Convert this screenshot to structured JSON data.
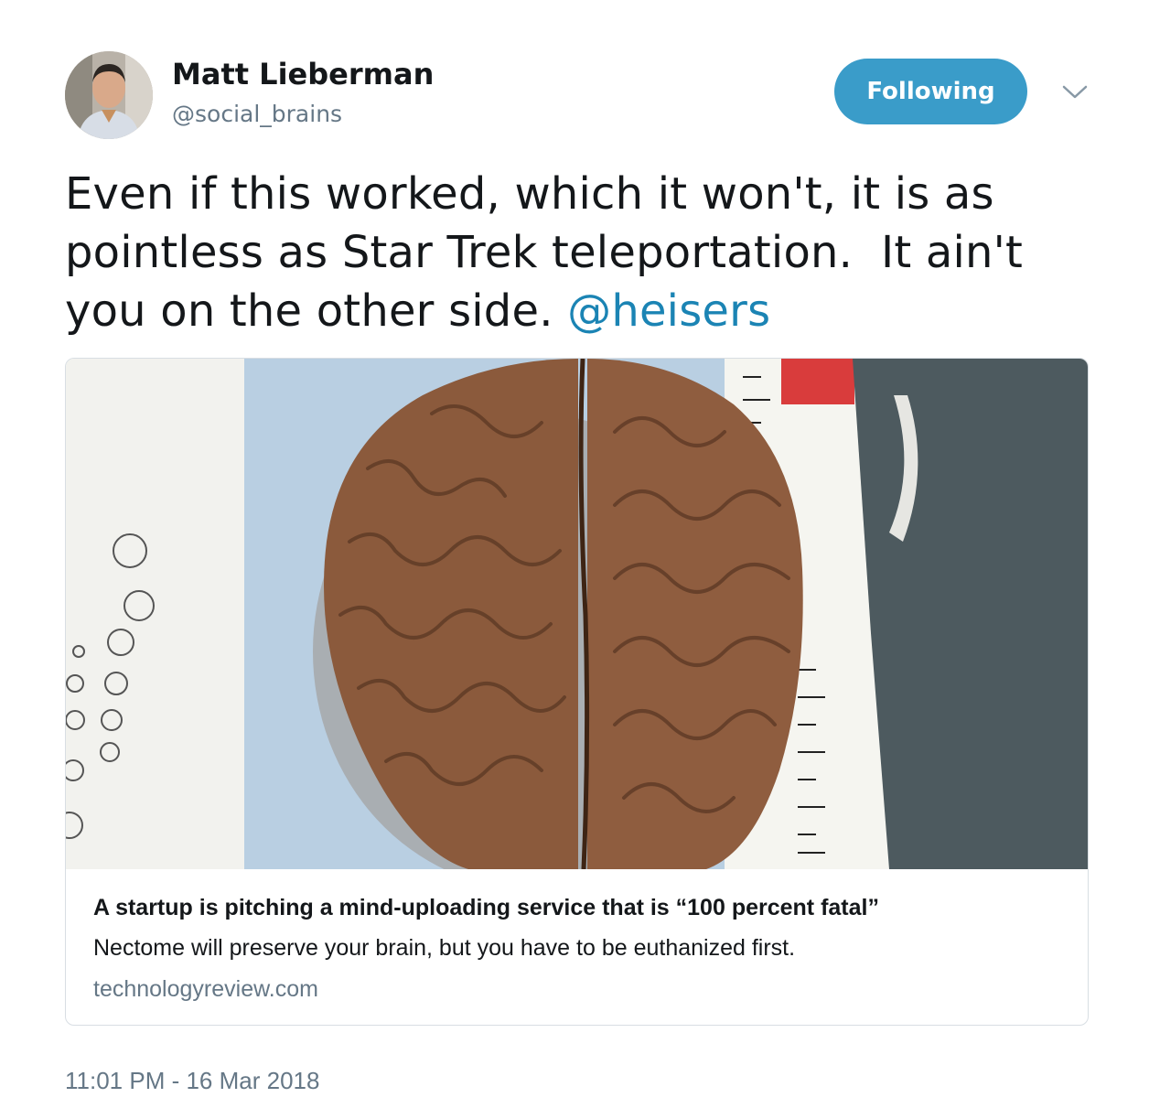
{
  "author": {
    "name": "Matt Lieberman",
    "handle": "@social_brains",
    "avatar_icon": "profile-photo"
  },
  "follow_button": {
    "label": "Following",
    "color": "#3a9cc9"
  },
  "menu_icon": "chevron-down-icon",
  "tweet": {
    "lines": [
      "Even if this worked, which it won't, it is as",
      "pointless as Star Trek teleportation.  It ain't",
      "you on the other side. "
    ],
    "mention": "@heisers",
    "mention_color": "#1b84b4"
  },
  "card": {
    "image_icon": "brain-photo",
    "title": "A startup is pitching a mind-uploading service that is “100 percent fatal”",
    "description": "Nectome will preserve your brain, but you have to be euthanized first.",
    "domain": "technologyreview.com"
  },
  "timestamp": "11:01 PM - 16 Mar 2018"
}
